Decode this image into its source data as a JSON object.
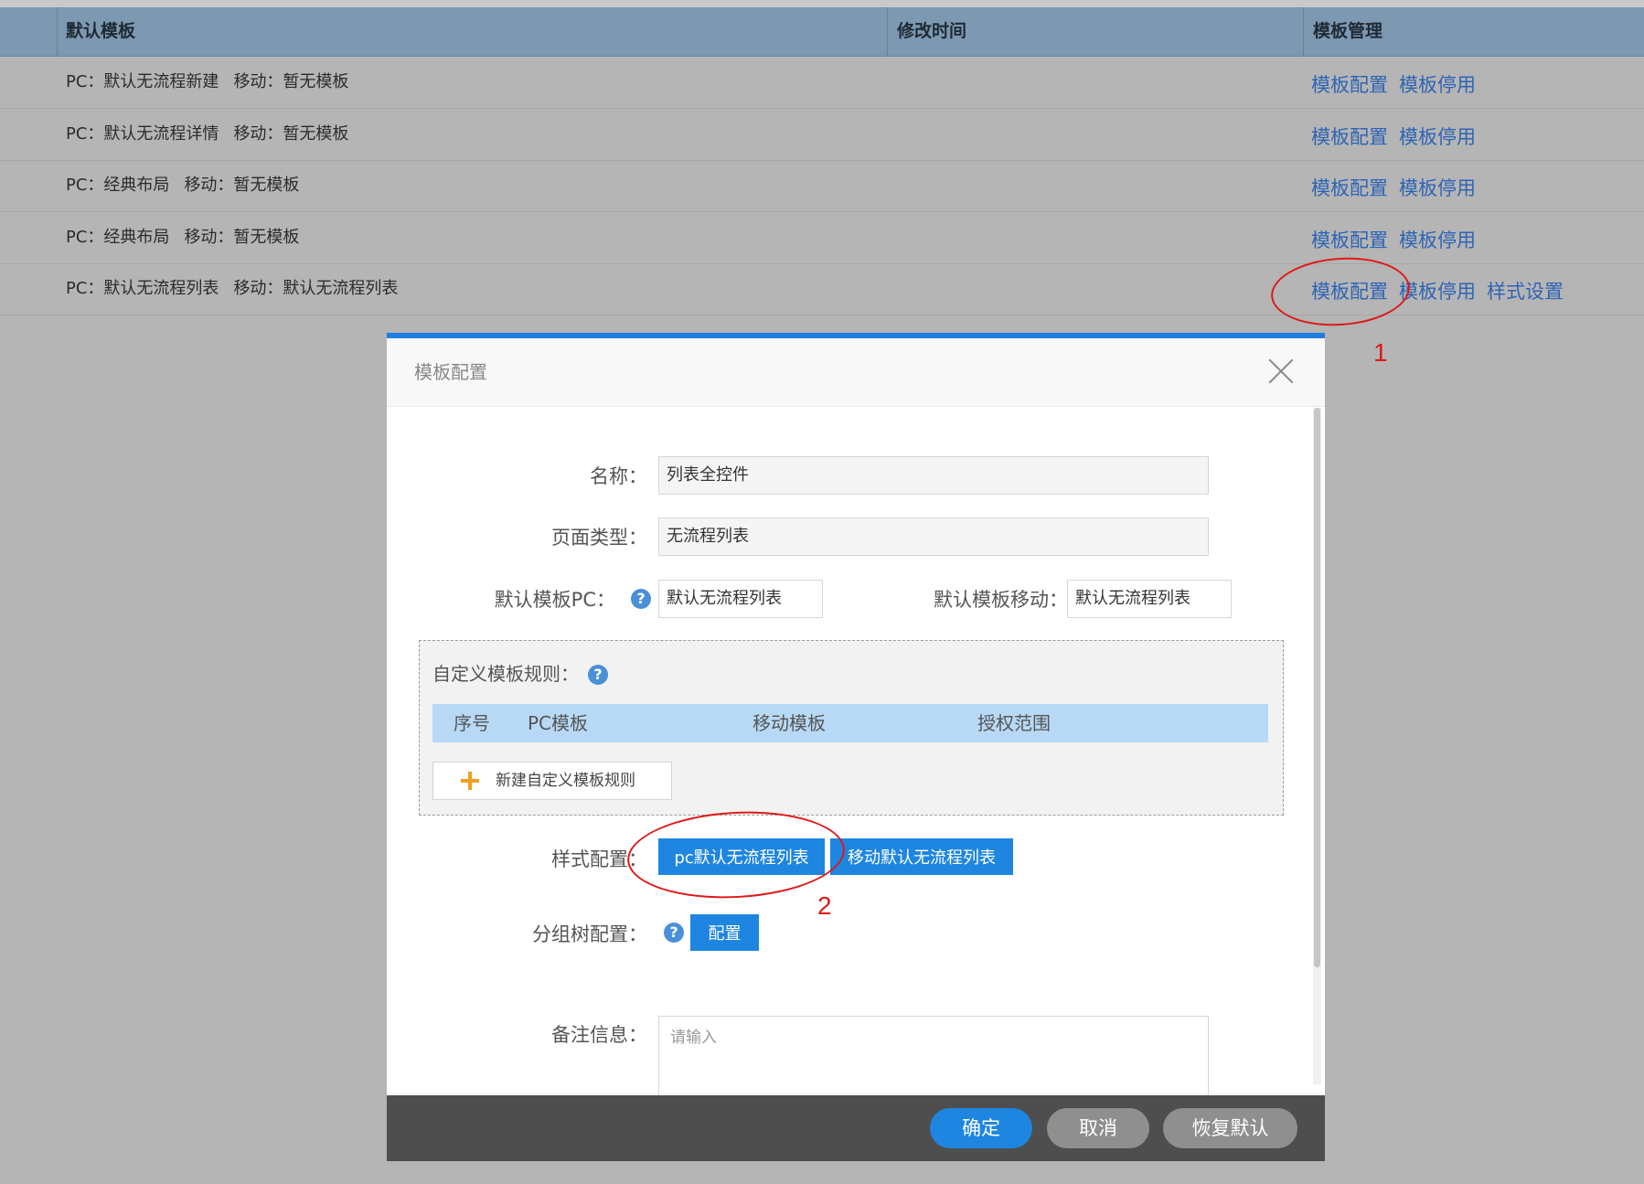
{
  "table": {
    "headers": [
      "默认模板",
      "修改时间",
      "模板管理"
    ],
    "rows": [
      {
        "pc": "PC：默认无流程新建",
        "mobile": "移动：暂无模板",
        "ops": [
          "模板配置",
          "模板停用"
        ]
      },
      {
        "pc": "PC：默认无流程详情",
        "mobile": "移动：暂无模板",
        "ops": [
          "模板配置",
          "模板停用"
        ]
      },
      {
        "pc": "PC：经典布局",
        "mobile": "移动：暂无模板",
        "ops": [
          "模板配置",
          "模板停用"
        ]
      },
      {
        "pc": "PC：经典布局",
        "mobile": "移动：暂无模板",
        "ops": [
          "模板配置",
          "模板停用"
        ]
      },
      {
        "pc": "PC：默认无流程列表",
        "mobile": "移动：默认无流程列表",
        "ops": [
          "模板配置",
          "模板停用",
          "样式设置"
        ]
      }
    ]
  },
  "annotations": {
    "one": "1",
    "two": "2",
    "color": "#e01818"
  },
  "modal": {
    "title": "模板配置",
    "fields": {
      "name_label": "名称：",
      "name_value": "列表全控件",
      "page_type_label": "页面类型：",
      "page_type_value": "无流程列表",
      "default_pc_label": "默认模板PC：",
      "default_pc_value": "默认无流程列表",
      "default_mobile_label": "默认模板移动：",
      "default_mobile_value": "默认无流程列表"
    },
    "rules": {
      "title": "自定义模板规则：",
      "columns": [
        "序号",
        "PC模板",
        "移动模板",
        "授权范围"
      ],
      "add_label": "新建自定义模板规则"
    },
    "style_config": {
      "label": "样式配置：",
      "pc_button": "pc默认无流程列表",
      "mobile_button": "移动默认无流程列表"
    },
    "group_tree": {
      "label": "分组树配置：",
      "button": "配置"
    },
    "remark": {
      "label": "备注信息：",
      "placeholder": "请输入"
    },
    "footer": {
      "confirm": "确定",
      "cancel": "取消",
      "restore": "恢复默认"
    }
  },
  "colors": {
    "accent": "#1e86e0",
    "header_bg": "#7d99b1",
    "link": "#2e64b5"
  }
}
